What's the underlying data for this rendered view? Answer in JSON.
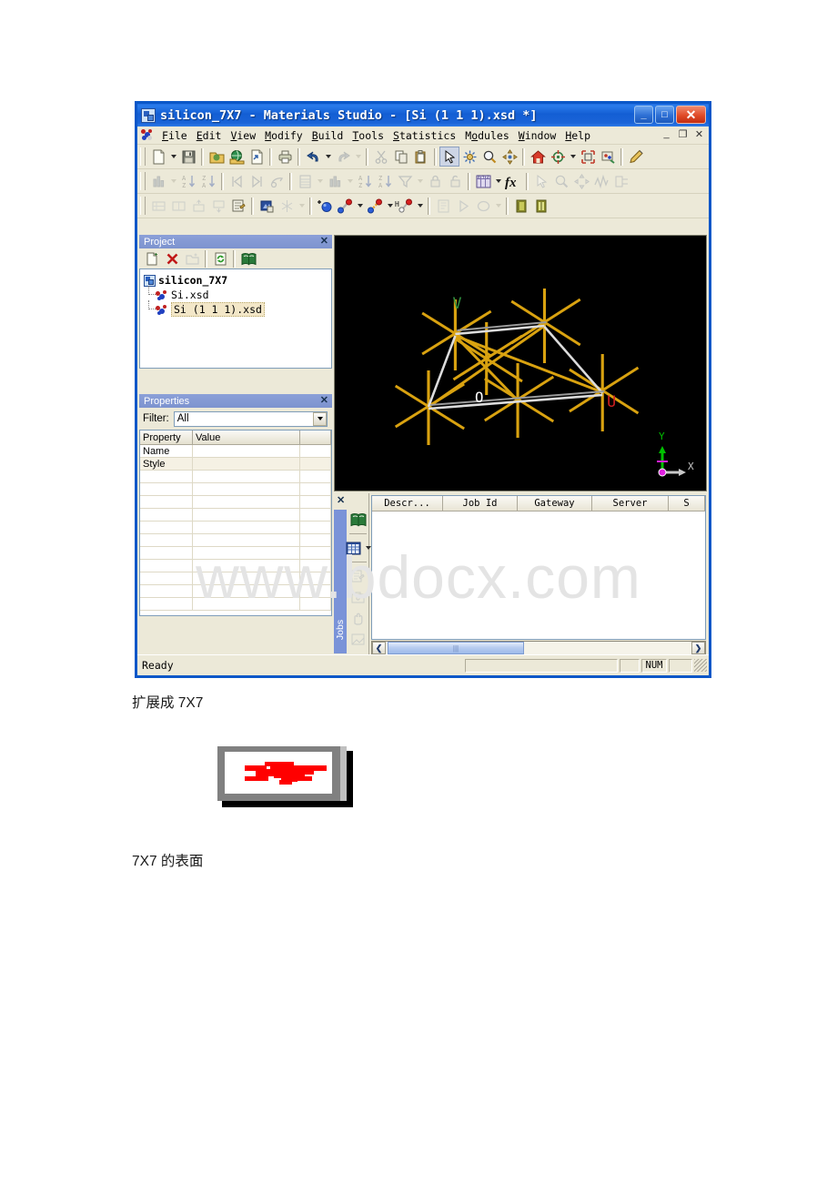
{
  "window": {
    "title": "silicon_7X7 - Materials Studio - [Si (1 1 1).xsd *]",
    "minimize_label": "_",
    "maximize_label": "□",
    "close_label": "✕",
    "titlebar_icon": "materials-studio-icon"
  },
  "menubar": {
    "items": [
      {
        "label": "File",
        "accel": "F"
      },
      {
        "label": "Edit",
        "accel": "E"
      },
      {
        "label": "View",
        "accel": "V"
      },
      {
        "label": "Modify",
        "accel": "M"
      },
      {
        "label": "Build",
        "accel": "B"
      },
      {
        "label": "Tools",
        "accel": "T"
      },
      {
        "label": "Statistics",
        "accel": "S"
      },
      {
        "label": "Modules",
        "accel": "o"
      },
      {
        "label": "Window",
        "accel": "W"
      },
      {
        "label": "Help",
        "accel": "H"
      }
    ],
    "mdi_minimize": "_",
    "mdi_restore": "❐",
    "mdi_close": "✕"
  },
  "toolbars": {
    "row1": [
      {
        "name": "new-document-button",
        "dropdown": true
      },
      {
        "name": "save-button"
      },
      {
        "name": "import-button"
      },
      {
        "name": "web-browse-button"
      },
      {
        "name": "export-button"
      },
      {
        "name": "print-button"
      },
      {
        "name": "undo-button",
        "dropdown": true
      },
      {
        "name": "redo-button",
        "dropdown": true,
        "disabled": true
      },
      {
        "name": "cut-button",
        "disabled": true
      },
      {
        "name": "copy-button"
      },
      {
        "name": "paste-button"
      },
      {
        "name": "select-tool-button",
        "pressed": true
      },
      {
        "name": "rotate-tool-button"
      },
      {
        "name": "zoom-tool-button"
      },
      {
        "name": "pan-tool-button"
      },
      {
        "name": "home-view-button"
      },
      {
        "name": "center-view-button",
        "dropdown": true
      },
      {
        "name": "fit-to-screen-button"
      },
      {
        "name": "display-style-button"
      },
      {
        "name": "annotation-pencil-button"
      }
    ],
    "row2": [
      {
        "name": "chart-button",
        "dropdown": true,
        "disabled": true
      },
      {
        "name": "sort-ascending-button",
        "disabled": true
      },
      {
        "name": "sort-descending-button",
        "disabled": true
      },
      {
        "name": "previous-frame-button",
        "disabled": true
      },
      {
        "name": "next-frame-button",
        "disabled": true
      },
      {
        "name": "animation-button",
        "disabled": true
      },
      {
        "name": "table-button",
        "dropdown": true,
        "disabled": true
      },
      {
        "name": "histogram-button",
        "dropdown": true,
        "disabled": true
      },
      {
        "name": "sort-a-z-button",
        "disabled": true
      },
      {
        "name": "sort-z-a-button",
        "disabled": true
      },
      {
        "name": "filter-button",
        "dropdown": true,
        "disabled": true
      },
      {
        "name": "lock-button",
        "disabled": true
      },
      {
        "name": "unlock-button",
        "disabled": true
      },
      {
        "name": "study-table-button",
        "dropdown": true
      },
      {
        "name": "function-button"
      },
      {
        "name": "pointer-tool-button",
        "disabled": true
      },
      {
        "name": "magnifier-tool-button",
        "disabled": true
      },
      {
        "name": "move-tool-button",
        "disabled": true
      },
      {
        "name": "measure-tool-button",
        "disabled": true
      },
      {
        "name": "graph-tool-button",
        "disabled": true
      }
    ],
    "row3": [
      {
        "name": "add-row-button",
        "disabled": true
      },
      {
        "name": "add-column-button",
        "disabled": true
      },
      {
        "name": "insert-above-button",
        "disabled": true
      },
      {
        "name": "insert-below-button",
        "disabled": true
      },
      {
        "name": "edit-properties-button"
      },
      {
        "name": "crystal-build-button"
      },
      {
        "name": "symmetry-button",
        "dropdown": true,
        "disabled": true
      },
      {
        "name": "sketch-atom-button"
      },
      {
        "name": "sketch-bond-button",
        "dropdown": true
      },
      {
        "name": "sketch-ring-button",
        "dropdown": true
      },
      {
        "name": "add-hydrogen-button",
        "dropdown": true
      },
      {
        "name": "calculation-button",
        "disabled": true
      },
      {
        "name": "run-button",
        "disabled": true
      },
      {
        "name": "job-status-button",
        "dropdown": true,
        "disabled": true
      },
      {
        "name": "server-gateway-button"
      },
      {
        "name": "server-console-button"
      }
    ]
  },
  "project_panel": {
    "caption": "Project",
    "close_label": "✕",
    "tools": [
      {
        "name": "new-project-button"
      },
      {
        "name": "delete-button"
      },
      {
        "name": "new-folder-button",
        "disabled": true
      },
      {
        "name": "refresh-button"
      },
      {
        "name": "open-library-button"
      }
    ],
    "tree": [
      {
        "label": "silicon_7X7",
        "level": 0,
        "icon": "project-icon",
        "selected": false
      },
      {
        "label": "Si.xsd",
        "level": 1,
        "icon": "molecule-icon",
        "selected": false
      },
      {
        "label": "Si (1 1 1).xsd",
        "level": 1,
        "icon": "molecule-icon",
        "selected": true
      }
    ]
  },
  "properties_panel": {
    "caption": "Properties",
    "close_label": "✕",
    "filter_label": "Filter:",
    "filter_value": "All",
    "columns": [
      "Property",
      "Value"
    ],
    "rows": [
      {
        "property": "Name",
        "value": ""
      },
      {
        "property": "Style",
        "value": ""
      }
    ]
  },
  "viewport": {
    "name": "3d-structure-viewport",
    "background": "#000000",
    "atom_color": "#e5a817",
    "bond_color": "#d8a10e",
    "lattice_color": "#d8d8d8",
    "labels": [
      {
        "text": "V",
        "color": "#2f8f3f"
      },
      {
        "text": "O",
        "color": "#ffffff"
      },
      {
        "text": "U",
        "color": "#d02020"
      }
    ],
    "axis_widget": {
      "x_label": "X",
      "y_label": "Y",
      "x_color": "#c8c8c8",
      "y_color": "#00c000",
      "origin_color": "#e020e0"
    }
  },
  "jobs_dock": {
    "tab_label": "Jobs",
    "close_label": "✕",
    "side_tools": [
      {
        "name": "open-library-button"
      },
      {
        "name": "job-table-button",
        "dropdown": true
      },
      {
        "name": "job-details-button",
        "disabled": true
      },
      {
        "name": "job-archive-button",
        "disabled": true
      },
      {
        "name": "hand-tool-button",
        "disabled": true
      },
      {
        "name": "job-settings-button",
        "disabled": true
      }
    ],
    "columns": [
      "Descr...",
      "Job Id",
      "Gateway",
      "Server",
      "S"
    ],
    "rows": [],
    "scroll_left_label": "❮",
    "scroll_right_label": "❯"
  },
  "statusbar": {
    "message": "Ready",
    "indicators": [
      "",
      "",
      "NUM",
      ""
    ]
  },
  "page": {
    "watermark": "www.bdocx.com",
    "caption_above": "扩展成 7X7",
    "caption_below": "7X7 的表面",
    "figure_name": "red-bowtie-figure",
    "figure_color": "#ff0000"
  }
}
